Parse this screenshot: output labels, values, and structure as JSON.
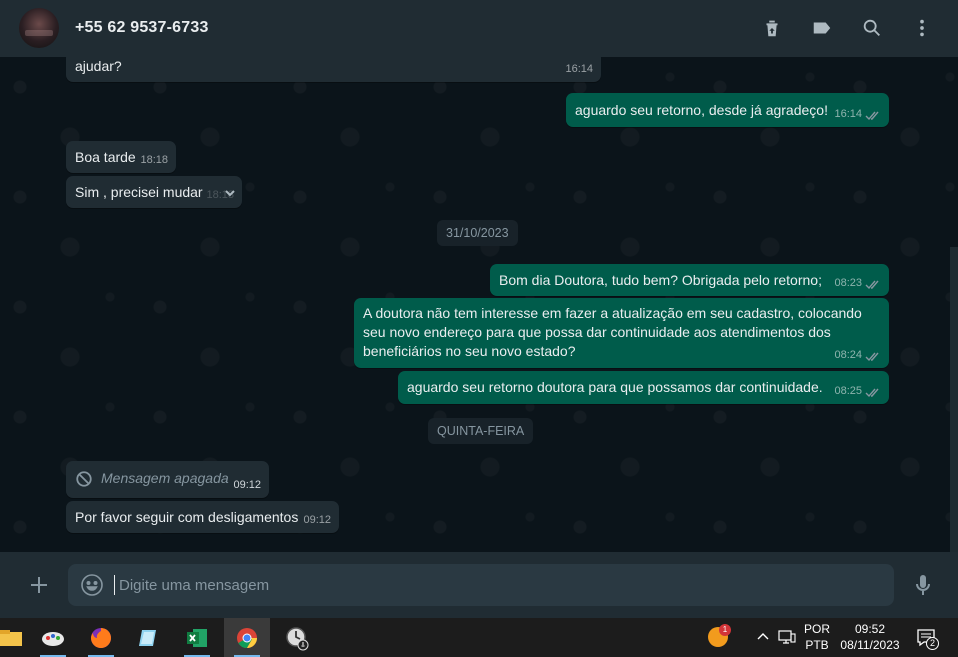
{
  "header": {
    "contact_name": "+55 62 9537-6733",
    "icons": [
      "archive-icon",
      "label-icon",
      "search-icon",
      "menu-icon"
    ]
  },
  "messages": [
    {
      "dir": "in",
      "text": "ajudar?",
      "time": "16:14"
    },
    {
      "dir": "out",
      "text": "aguardo seu retorno, desde já agradeço!",
      "time": "16:14"
    },
    {
      "dir": "in",
      "text": "Boa tarde",
      "time": "18:18"
    },
    {
      "dir": "in",
      "text": "Sim , precisei mudar",
      "time": "18:18"
    },
    {
      "dir": "out",
      "text": "Bom dia Doutora, tudo bem? Obrigada pelo retorno;",
      "time": "08:23"
    },
    {
      "dir": "out",
      "text": "A doutora não tem interesse em fazer a atualização em seu cadastro, colocando seu novo endereço para que possa dar continuidade aos atendimentos dos beneficiários no seu novo estado?",
      "time": "08:24"
    },
    {
      "dir": "out",
      "text": "aguardo seu retorno doutora para que possamos dar continuidade.",
      "time": "08:25"
    },
    {
      "dir": "in",
      "text": "Mensagem apagada",
      "time": "09:12"
    },
    {
      "dir": "in",
      "text": "Por favor seguir com desligamentos",
      "time": "09:12"
    }
  ],
  "date_chips": {
    "first": "31/10/2023",
    "second": "QUINTA-FEIRA"
  },
  "composer": {
    "placeholder": "Digite uma mensagem"
  },
  "taskbar": {
    "apps": [
      "file-explorer-icon",
      "paint-icon",
      "firefox-icon",
      "notes-icon",
      "excel-icon",
      "chrome-icon",
      "clock-app-icon"
    ],
    "badge_count": "1",
    "language_top": "POR",
    "language_bottom": "PTB",
    "time": "09:52",
    "date": "08/11/2023",
    "notification_count": "2"
  },
  "colors": {
    "header_bg": "#202c33",
    "chat_bg": "#0b141a",
    "bubble_in": "#202c33",
    "bubble_out": "#005c4b",
    "taskbar_bg": "#1c1c1c"
  }
}
